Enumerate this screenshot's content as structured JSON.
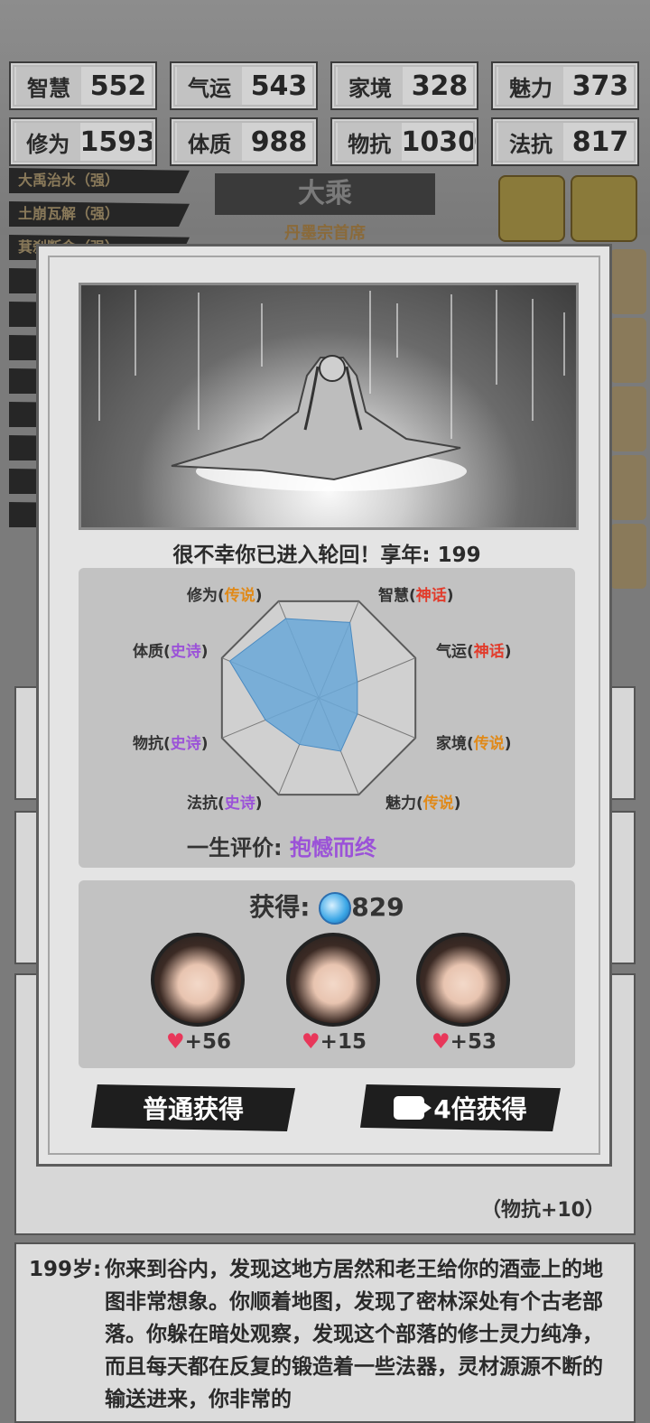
{
  "stats": [
    {
      "k": "智慧",
      "v": "552"
    },
    {
      "k": "气运",
      "v": "543"
    },
    {
      "k": "家境",
      "v": "328"
    },
    {
      "k": "魅力",
      "v": "373"
    },
    {
      "k": "修为",
      "v": "1593"
    },
    {
      "k": "体质",
      "v": "988"
    },
    {
      "k": "物抗",
      "v": "1030"
    },
    {
      "k": "法抗",
      "v": "817"
    }
  ],
  "skills": [
    "大禹治水（强）",
    "土崩瓦解（强）",
    "萁刹断命（强）"
  ],
  "rank": "大乘",
  "sect": "丹墨宗首席",
  "modal": {
    "death_text": "很不幸你已进入轮回！享年: 199",
    "radar": {
      "labels": [
        {
          "name": "修为",
          "grade": "传说",
          "color": "gold"
        },
        {
          "name": "智慧",
          "grade": "神话",
          "color": "red"
        },
        {
          "name": "体质",
          "grade": "史诗",
          "color": "purple"
        },
        {
          "name": "气运",
          "grade": "神话",
          "color": "red"
        },
        {
          "name": "物抗",
          "grade": "史诗",
          "color": "purple"
        },
        {
          "name": "家境",
          "grade": "传说",
          "color": "gold"
        },
        {
          "name": "法抗",
          "grade": "史诗",
          "color": "purple"
        },
        {
          "name": "魅力",
          "grade": "传说",
          "color": "gold"
        }
      ],
      "values": [
        0.82,
        0.78,
        0.92,
        0.4,
        0.55,
        0.4,
        0.48,
        0.55
      ]
    },
    "evaluation_label": "一生评价:",
    "evaluation_value": "抱憾而终",
    "gain_label": "获得:",
    "gain_amount": "829",
    "rewards": [
      "+56",
      "+15",
      "+53"
    ],
    "btn_normal": "普通获得",
    "btn_ad": "4倍获得"
  },
  "note": "（物抗+10）",
  "story": {
    "age": "199岁:",
    "text": "你来到谷内，发现这地方居然和老王给你的酒壶上的地图非常想象。你顺着地图，发现了密林深处有个古老部落。你躲在暗处观察，发现这个部落的修士灵力纯净，而且每天都在反复的锻造着一些法器，灵材源源不断的输送进来，你非常的"
  }
}
